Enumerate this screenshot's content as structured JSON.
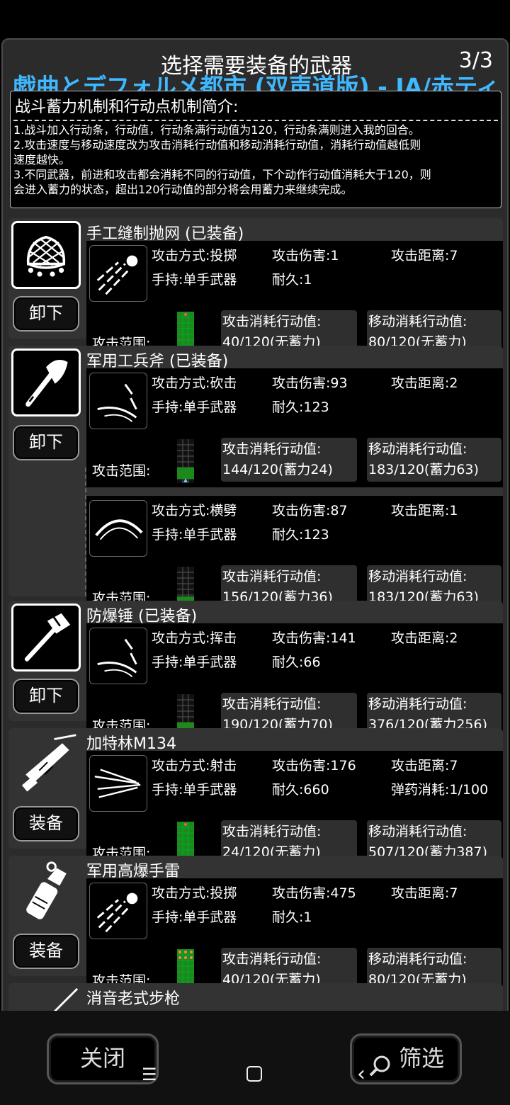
{
  "header": {
    "title": "选择需要装备的武器",
    "page_indicator": "3/3",
    "now_playing": "戯曲とデフォルメ都市 (双声道版) - IA/赤ティン"
  },
  "intro": {
    "heading": "战斗蓄力机制和行动点机制简介:",
    "lines": [
      "1.战斗加入行动条，行动值，行动条满行动值为120，行动条满则进入我的回合。",
      "2.攻击速度与移动速度改为攻击消耗行动值和移动消耗行动值，消耗行动值越低则",
      "速度越快。",
      "3.不同武器，前进和攻击都会消耗不同的行动值，下个动作行动值消耗大于120，则",
      "会进入蓄力的状态，超出120行动值的部分将会用蓄力来继续完成。"
    ]
  },
  "labels": {
    "range": "攻击范围:",
    "atk_cost": "攻击消耗行动值:",
    "move_cost": "移动消耗行动值:"
  },
  "weapons": [
    {
      "name": "手工缝制抛网 (已装备)",
      "icon": "net-icon",
      "action": "卸下",
      "modes": [
        {
          "type": "攻击方式:投掷",
          "damage": "攻击伤害:1",
          "distance": "攻击距离:7",
          "hold": "手持:单手武器",
          "durability": "耐久:1",
          "extra": "",
          "atk_cost": "40/120(无蓄力)",
          "move_cost": "80/120(无蓄力)"
        }
      ]
    },
    {
      "name": "军用工兵斧 (已装备)",
      "icon": "axe-icon",
      "action": "卸下",
      "modes": [
        {
          "type": "攻击方式:砍击",
          "damage": "攻击伤害:93",
          "distance": "攻击距离:2",
          "hold": "手持:单手武器",
          "durability": "耐久:123",
          "extra": "",
          "atk_cost": "144/120(蓄力24)",
          "move_cost": "183/120(蓄力63)"
        },
        {
          "type": "攻击方式:横劈",
          "damage": "攻击伤害:87",
          "distance": "攻击距离:1",
          "hold": "手持:单手武器",
          "durability": "耐久:123",
          "extra": "",
          "atk_cost": "156/120(蓄力36)",
          "move_cost": "183/120(蓄力63)"
        }
      ]
    },
    {
      "name": "防爆锤 (已装备)",
      "icon": "hammer-icon",
      "action": "卸下",
      "modes": [
        {
          "type": "攻击方式:挥击",
          "damage": "攻击伤害:141",
          "distance": "攻击距离:2",
          "hold": "手持:单手武器",
          "durability": "耐久:66",
          "extra": "",
          "atk_cost": "190/120(蓄力70)",
          "move_cost": "376/120(蓄力256)"
        }
      ]
    },
    {
      "name": "加特林M134",
      "icon": "gatling-icon",
      "action": "装备",
      "modes": [
        {
          "type": "攻击方式:射击",
          "damage": "攻击伤害:176",
          "distance": "攻击距离:7",
          "hold": "手持:单手武器",
          "durability": "耐久:660",
          "extra": "弹药消耗:1/100",
          "atk_cost": "24/120(无蓄力)",
          "move_cost": "507/120(蓄力387)"
        }
      ]
    },
    {
      "name": "军用高爆手雷",
      "icon": "grenade-icon",
      "action": "装备",
      "modes": [
        {
          "type": "攻击方式:投掷",
          "damage": "攻击伤害:475",
          "distance": "攻击距离:7",
          "hold": "手持:单手武器",
          "durability": "耐久:1",
          "extra": "",
          "atk_cost": "40/120(无蓄力)",
          "move_cost": "80/120(无蓄力)"
        }
      ]
    },
    {
      "name": "消音老式步枪",
      "icon": "rifle-icon",
      "action": "",
      "modes": []
    }
  ],
  "footer": {
    "close_label": "关闭",
    "filter_label": "筛选",
    "filter_icon": "magnifier-icon"
  },
  "nav": {
    "menu_icon": "menu-icon",
    "home_icon": "home-icon",
    "back_icon": "back-icon"
  }
}
